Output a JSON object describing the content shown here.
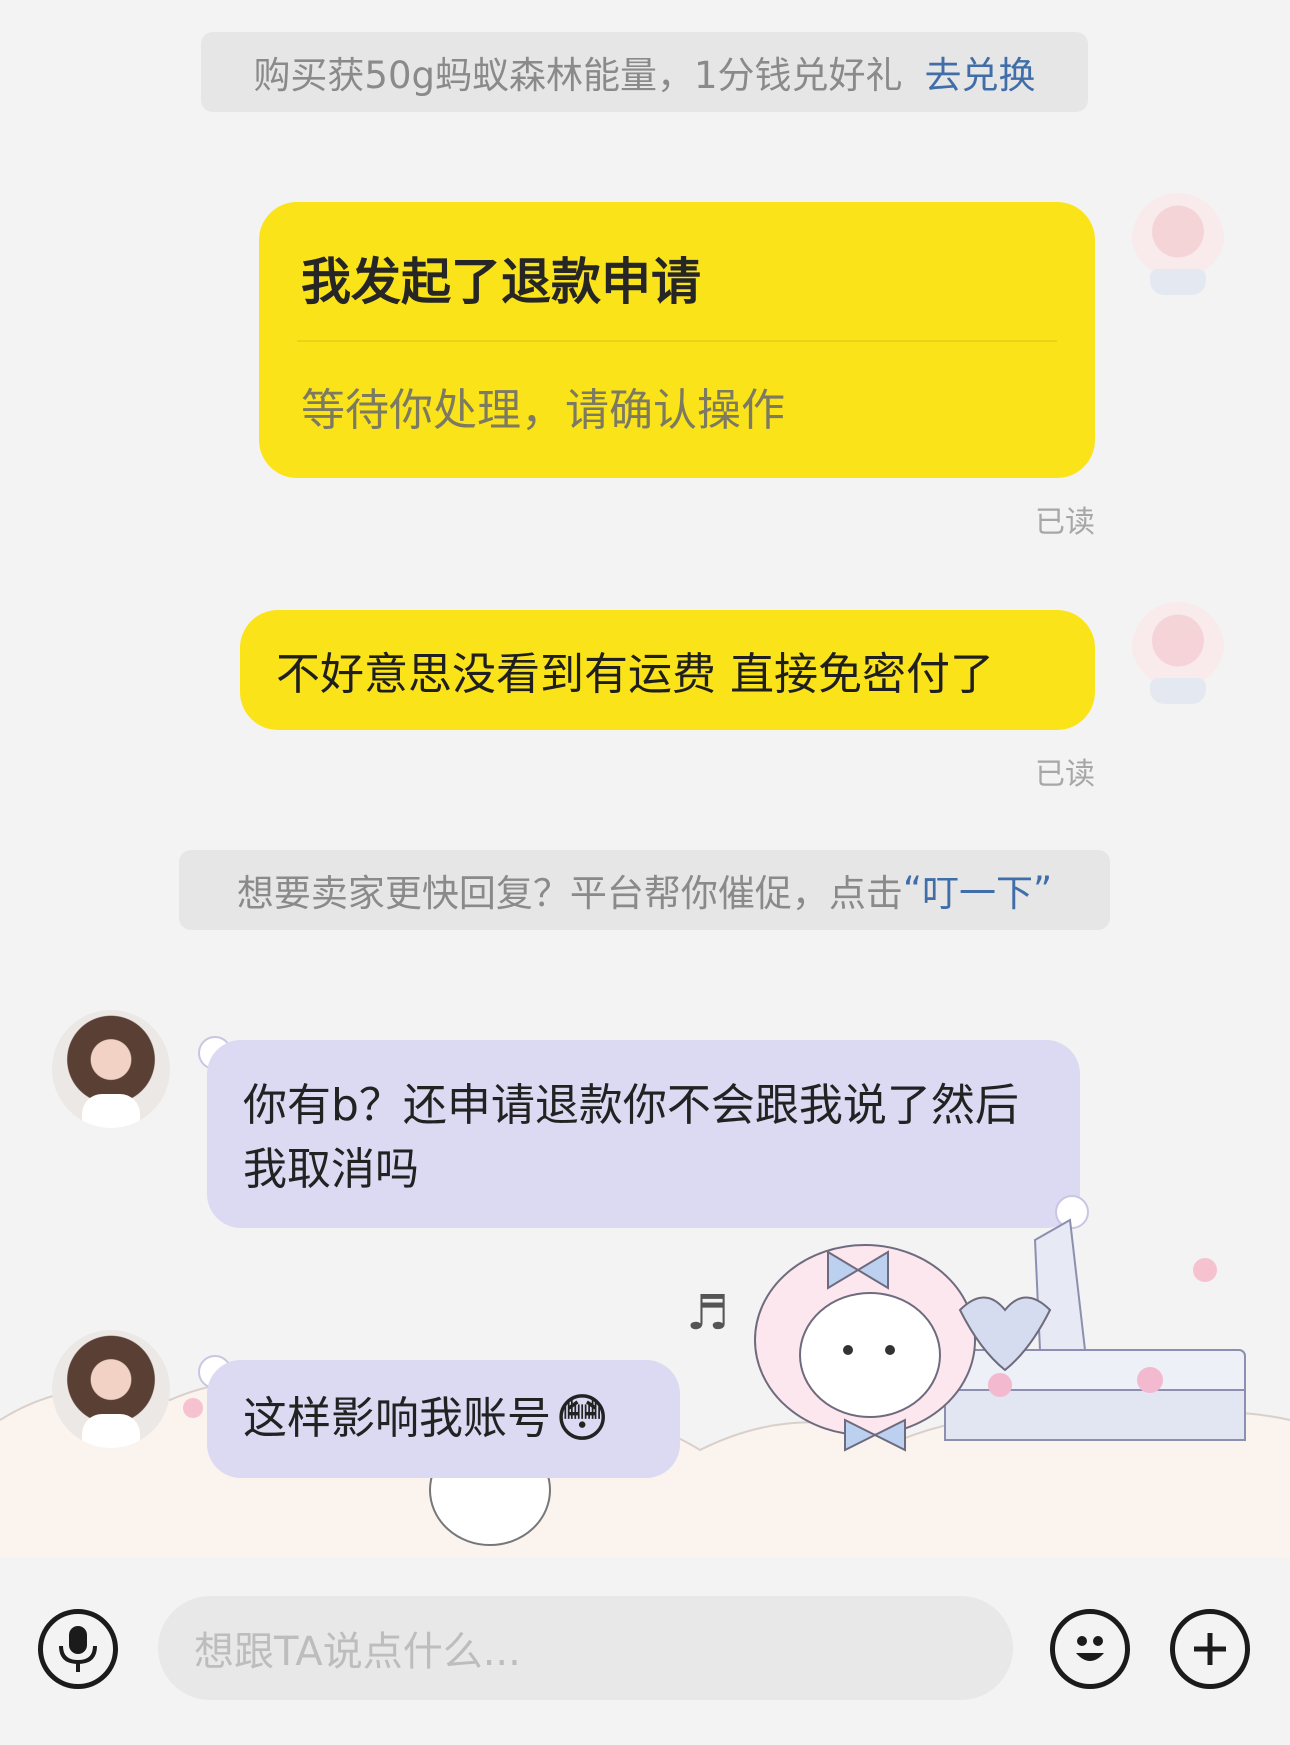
{
  "system_notice_1": {
    "text": "购买获50g蚂蚁森林能量，1分钱兑好礼",
    "link": "去兑换"
  },
  "refund_card": {
    "title": "我发起了退款申请",
    "subtitle": "等待你处理，请确认操作",
    "status": "已读"
  },
  "message_sent_2": {
    "text": "不好意思没看到有运费 直接免密付了",
    "status": "已读"
  },
  "system_notice_2": {
    "text": "想要卖家更快回复？平台帮你催促，点击",
    "link_quote_open": "“",
    "link": "叮一下",
    "link_quote_close": "”"
  },
  "message_received_1": {
    "text": "你有b？还申请退款你不会跟我说了然后我取消吗"
  },
  "message_received_2": {
    "text": "这样影响我账号",
    "emoji": "😳"
  },
  "input_bar": {
    "placeholder": "想跟TA说点什么..."
  },
  "icons": {
    "voice": "microphone-icon",
    "emoji": "smiley-icon",
    "more": "plus-icon"
  },
  "colors": {
    "sent_bubble": "#fbe31a",
    "received_bubble": "#dcd9f3",
    "link": "#3f6ea8",
    "notice_bg": "#e6e6e6"
  }
}
